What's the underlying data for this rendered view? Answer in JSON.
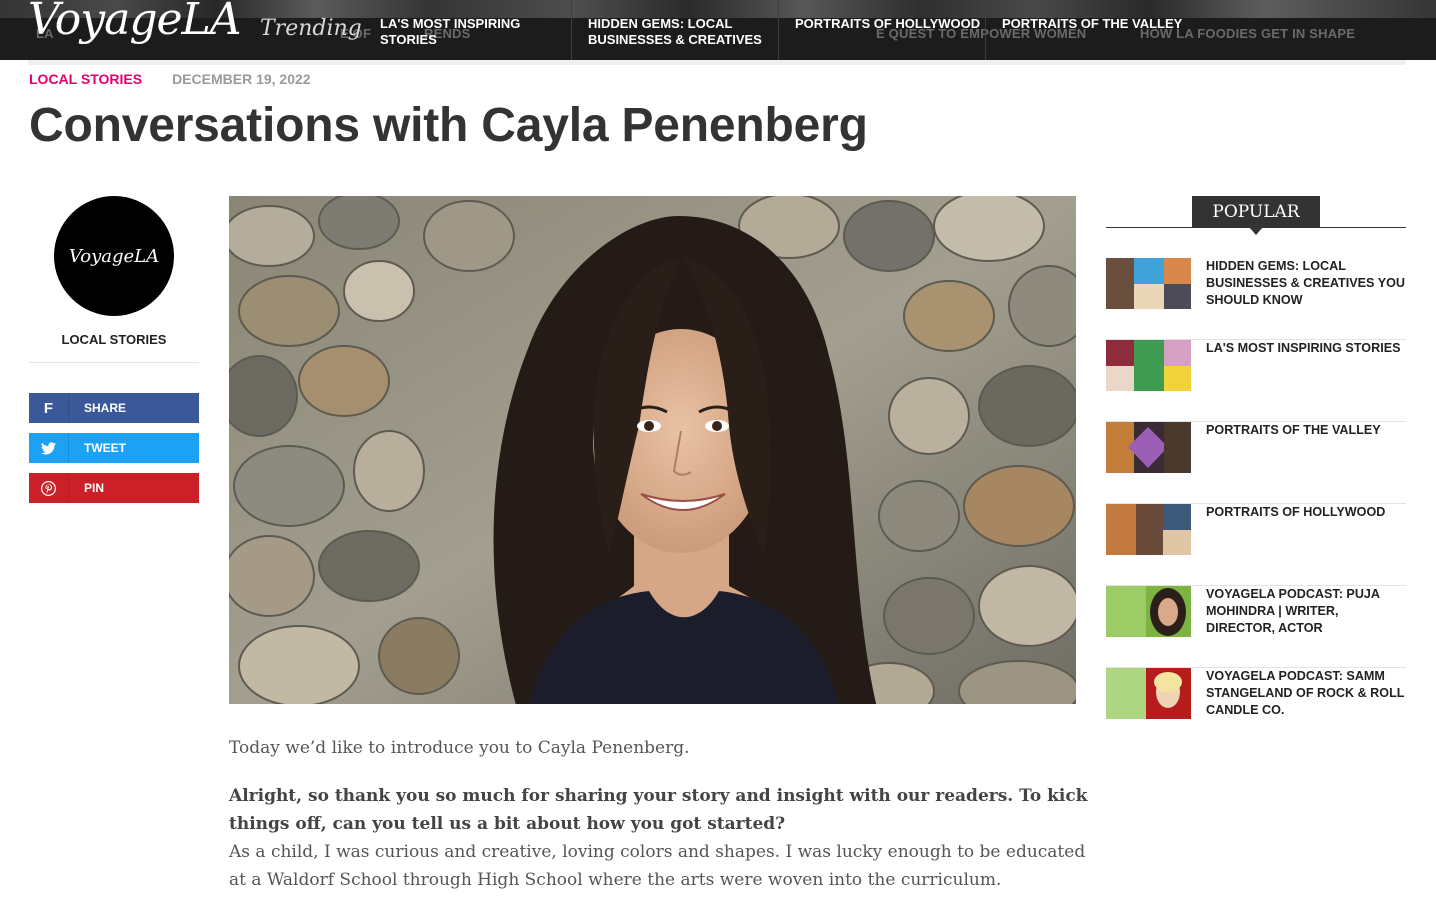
{
  "header": {
    "logo": "VoyageLA",
    "trending_label": "Trending",
    "trending_links": [
      "LA's Most Inspiring Stories",
      "Hidden Gems: Local Businesses & Creatives",
      "Portraits of Hollywood",
      "Portraits of the Valley"
    ],
    "background_ghost_text": [
      "LA",
      "E OF",
      "RENDS",
      "E QUEST TO EMPOWER WOMEN",
      "HOW LA FOODIES GET IN SHAPE"
    ]
  },
  "article": {
    "category": "Local Stories",
    "date": "December 19, 2022",
    "title": "Conversations with Cayla Penenberg",
    "intro": "Today we’d like to introduce you to Cayla Penenberg.",
    "question": "Alright, so thank you so much for sharing your story and insight with our readers. To kick things off, can you tell us a bit about how you got started?",
    "answer": "As a child, I was curious and creative, loving colors and shapes. I was lucky enough to be educated at a Waldorf School through High School where the arts were woven into the curriculum."
  },
  "author_rail": {
    "avatar_text": "VoyageLA",
    "category": "Local Stories",
    "share_buttons": [
      {
        "label": "Share",
        "icon": "facebook-icon",
        "color": "#3b5998"
      },
      {
        "label": "Tweet",
        "icon": "twitter-icon",
        "color": "#1da1f2"
      },
      {
        "label": "Pin",
        "icon": "pinterest-icon",
        "color": "#cb2027"
      }
    ]
  },
  "sidebar": {
    "heading": "Popular",
    "items": [
      {
        "title": "Hidden Gems: Local Businesses & Creatives You Should Know"
      },
      {
        "title": "LA's Most Inspiring Stories"
      },
      {
        "title": "Portraits of the Valley"
      },
      {
        "title": "Portraits of Hollywood"
      },
      {
        "title": "VoyageLA Podcast: Puja Mohindra | Writer, Director, Actor"
      },
      {
        "title": "VoyageLA Podcast: Samm Stangeland of Rock & Roll Candle Co."
      }
    ]
  },
  "colors": {
    "accent": "#e3006f",
    "topbar": "#1c1c1c",
    "facebook": "#3b5998",
    "twitter": "#1da1f2",
    "pinterest": "#cb2027"
  }
}
